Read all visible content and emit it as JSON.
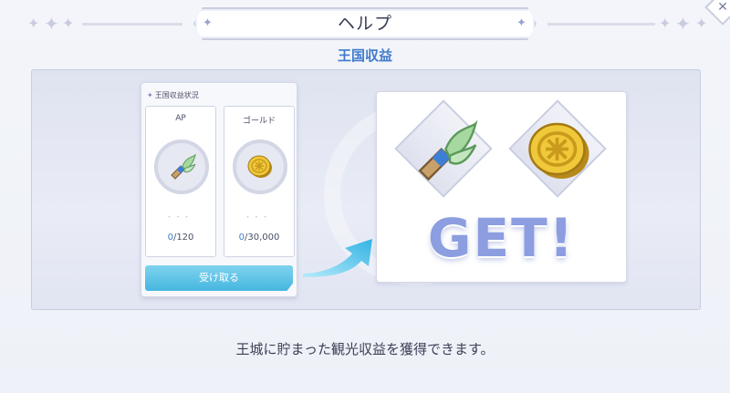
{
  "dialog": {
    "title": "ヘルプ",
    "subtitle": "王国収益",
    "description": "王城に貯まった観光収益を獲得できます。"
  },
  "panel": {
    "header": "王国収益状況",
    "resources": [
      {
        "label": "AP",
        "current": "0",
        "max": "/120",
        "icon": "ap-wing-icon"
      },
      {
        "label": "ゴールド",
        "current": "0",
        "max": "/30,000",
        "icon": "gold-coin-icon"
      }
    ],
    "claim_label": "受け取る"
  },
  "reward": {
    "text": "GET!",
    "icons": [
      "ap-wing-icon",
      "gold-coin-icon"
    ]
  },
  "icons": {
    "close": "close-icon"
  },
  "colors": {
    "accent": "#3f7bcc",
    "button": "#45b6df",
    "get_text": "#8c9ee0"
  }
}
